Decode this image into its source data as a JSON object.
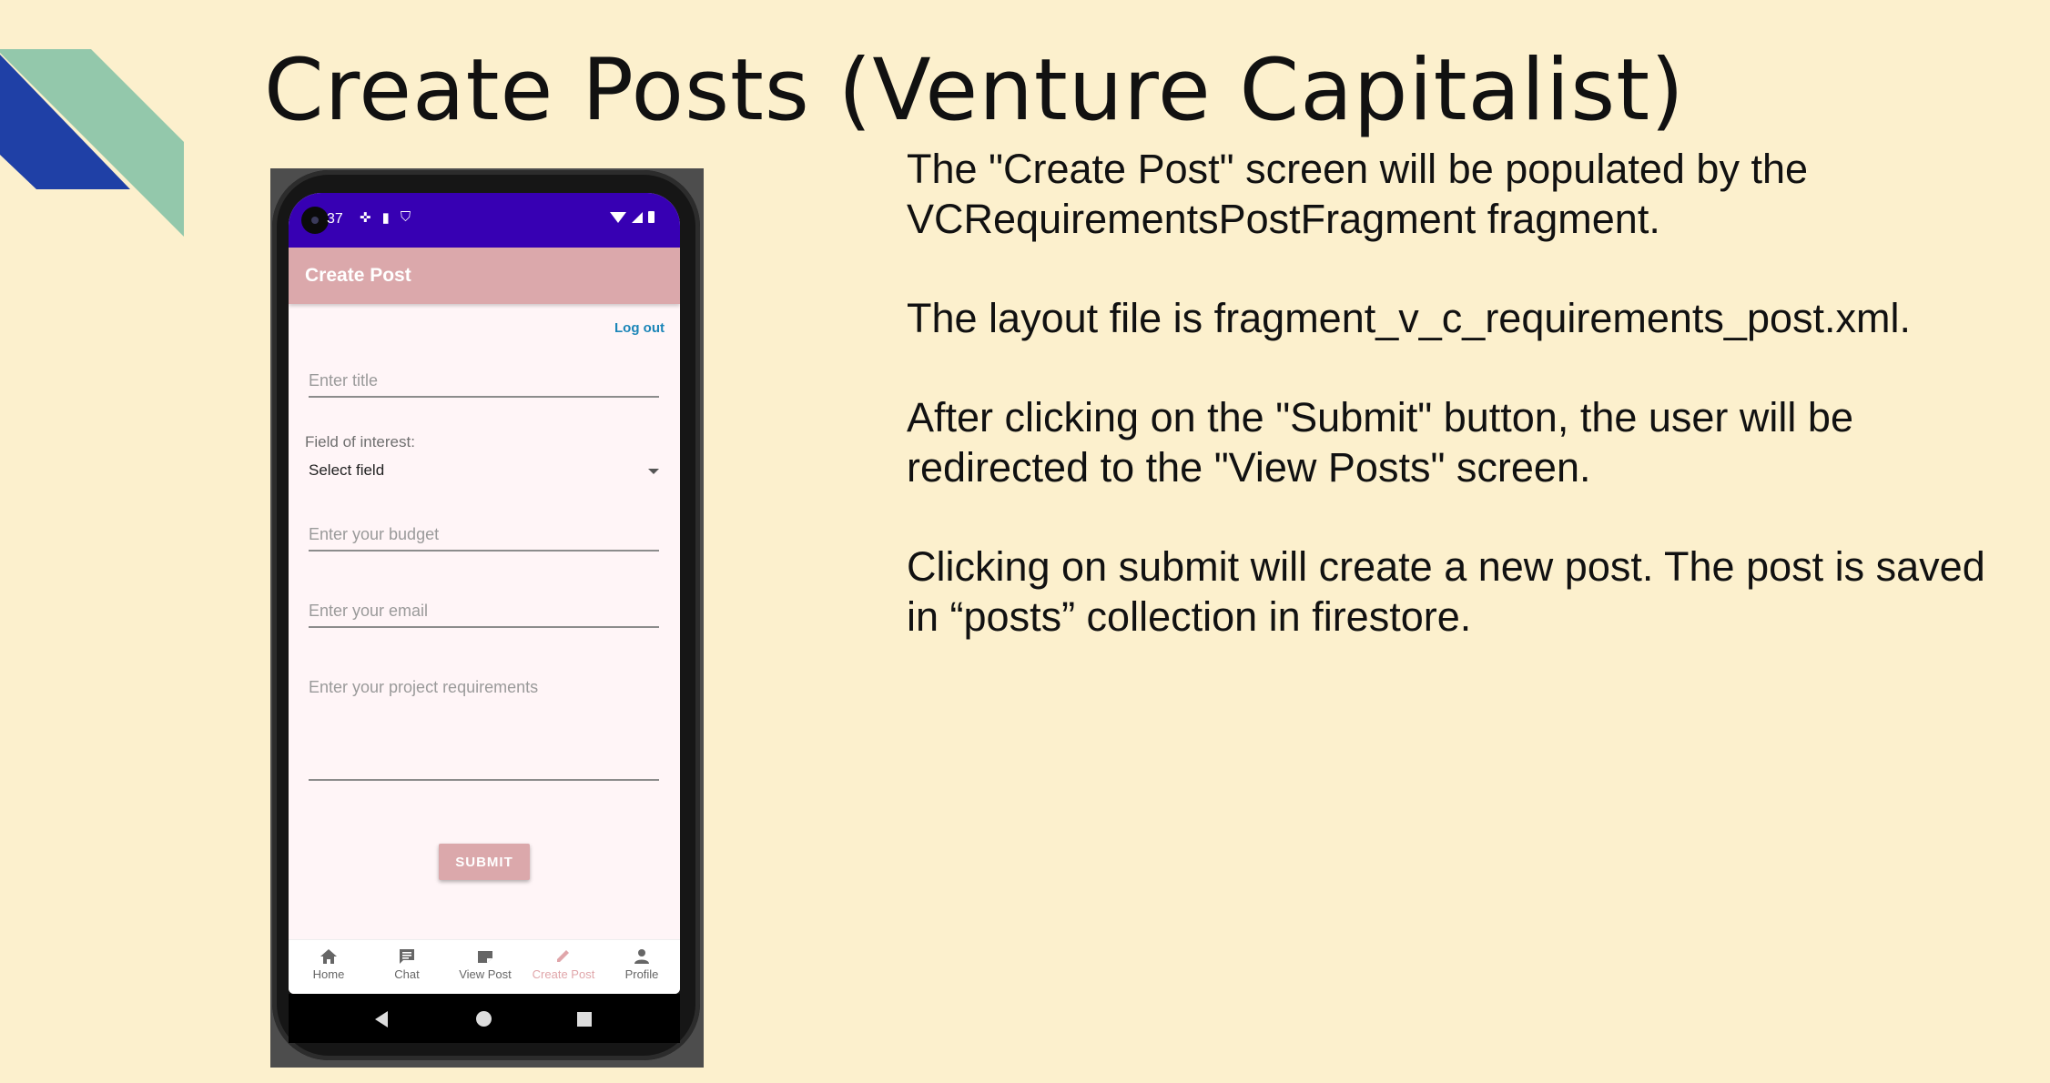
{
  "colors": {
    "background": "#fcf0cd",
    "deco_green": "#93c8ab",
    "deco_blue": "#1f40a6",
    "statusbar": "#3700b3",
    "appbar": "#dba8ab",
    "accent_link": "#1c86b8"
  },
  "slide": {
    "title": "Create Posts (Venture Capitalist)",
    "paragraphs": [
      "The \"Create Post\" screen will be populated by the VCRequirementsPostFragment fragment.",
      "The layout file is fragment_v_c_requirements_post.xml.",
      "After clicking on the \"Submit\" button, the user will be redirected to the \"View Posts\" screen.",
      "Clicking on submit will create a new post. The post is saved in “posts” collection in firestore."
    ]
  },
  "phone": {
    "status_bar": {
      "time": "37",
      "left_icons": [
        "camera-icon",
        "mic-icon",
        "sim-icon",
        "shield-icon"
      ],
      "right_icons": [
        "wifi-icon",
        "signal-icon",
        "battery-icon"
      ]
    },
    "app_bar": {
      "title": "Create Post"
    },
    "logout_label": "Log out",
    "form": {
      "title_placeholder": "Enter title",
      "interest_label": "Field of interest:",
      "interest_selected": "Select field",
      "budget_placeholder": "Enter your budget",
      "email_placeholder": "Enter your email",
      "requirements_placeholder": "Enter your project requirements",
      "submit_label": "SUBMIT"
    },
    "bottom_nav": [
      {
        "label": "Home",
        "icon": "home-icon",
        "active": false
      },
      {
        "label": "Chat",
        "icon": "chat-icon",
        "active": false
      },
      {
        "label": "View Post",
        "icon": "post-icon",
        "active": false
      },
      {
        "label": "Create Post",
        "icon": "pencil-icon",
        "active": true
      },
      {
        "label": "Profile",
        "icon": "person-icon",
        "active": false
      }
    ],
    "system_nav": [
      "back-icon",
      "home-circle-icon",
      "recents-icon"
    ]
  }
}
